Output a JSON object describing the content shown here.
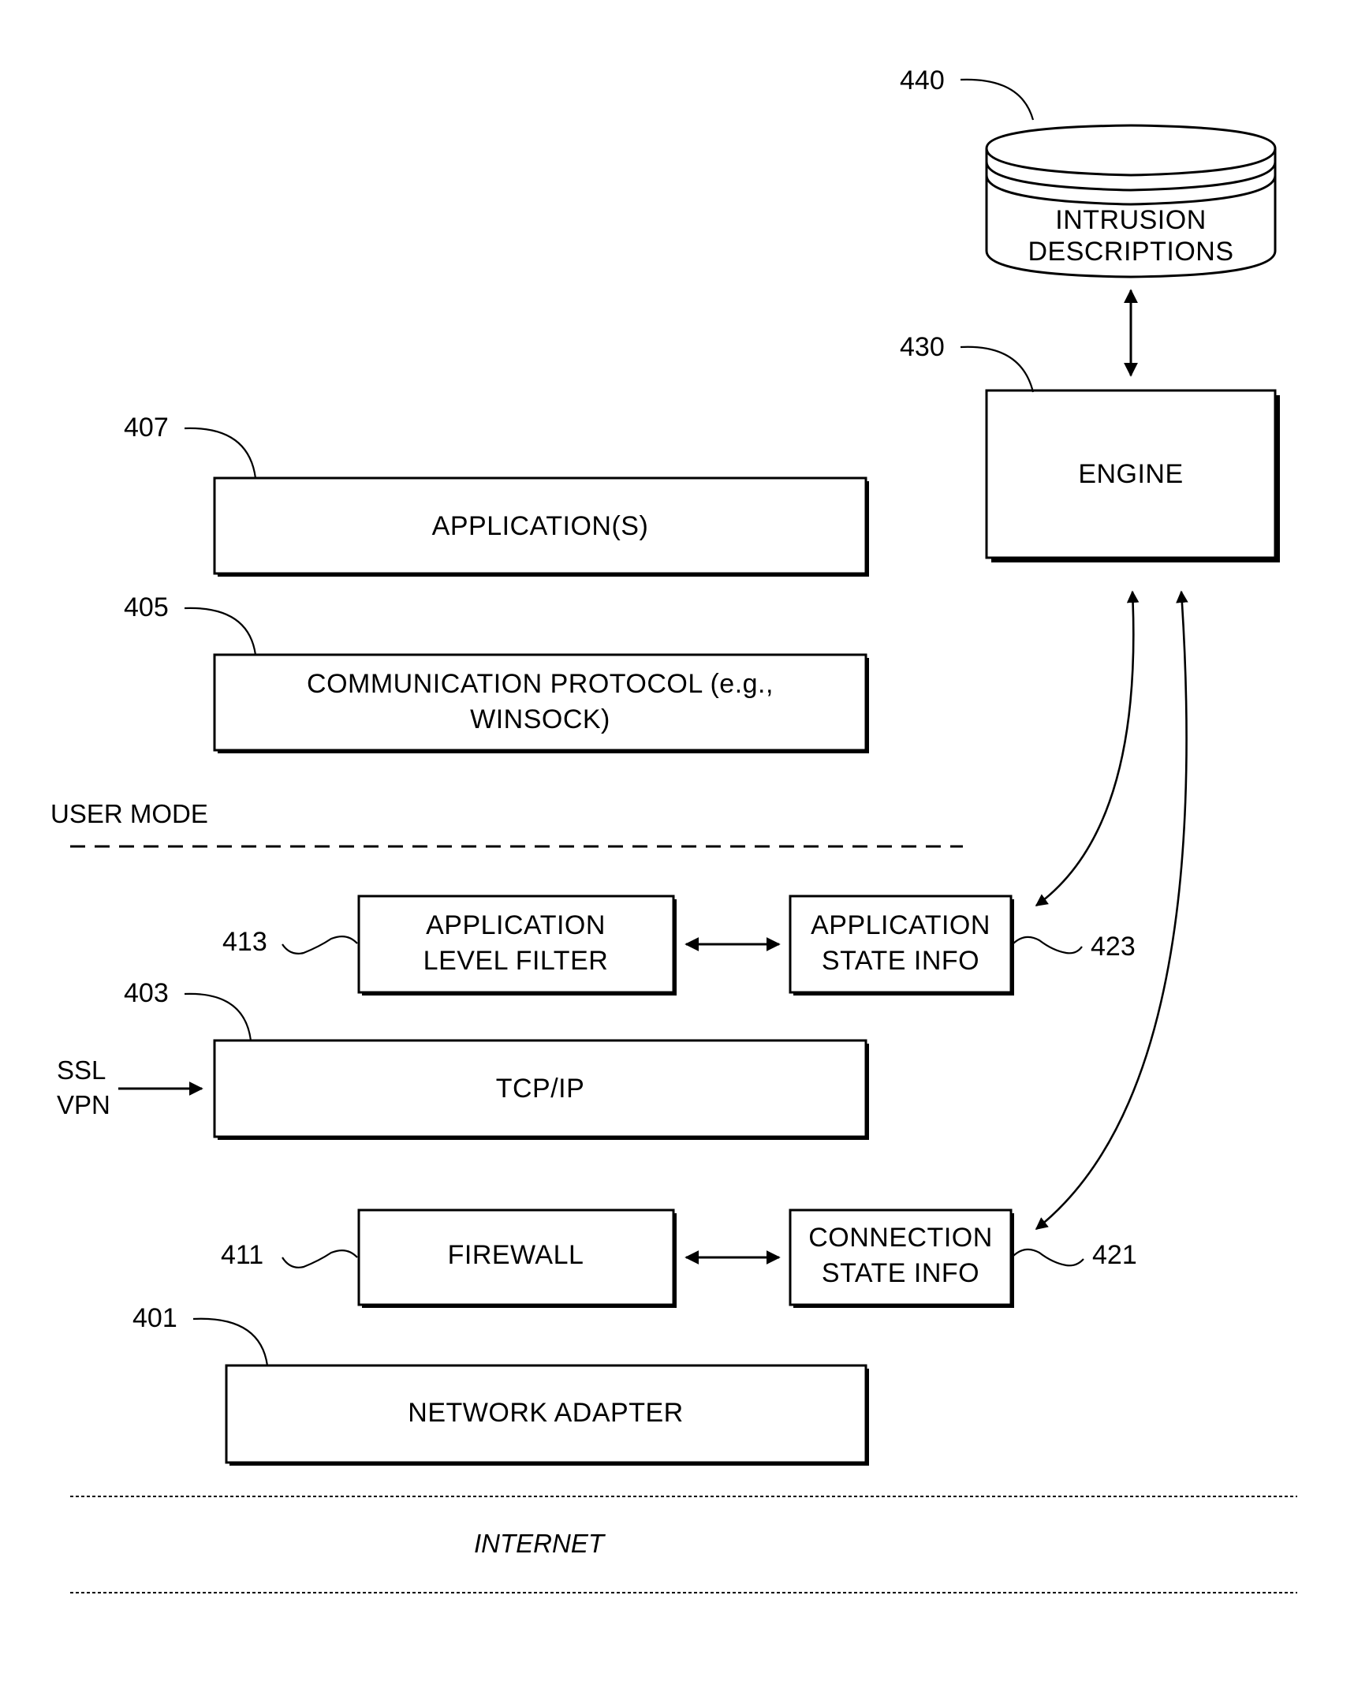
{
  "diagram": {
    "colors": {
      "ink": "#000000",
      "background": "#ffffff"
    },
    "database": {
      "ref": "440",
      "lines": [
        "INTRUSION",
        "DESCRIPTIONS"
      ]
    },
    "engine": {
      "ref": "430",
      "label": "ENGINE"
    },
    "applications": {
      "ref": "407",
      "label": "APPLICATION(S)"
    },
    "comm_protocol": {
      "ref": "405",
      "lines": [
        "COMMUNICATION PROTOCOL (e.g.,",
        "WINSOCK)"
      ]
    },
    "user_mode": {
      "label": "USER MODE"
    },
    "app_level_filter": {
      "ref": "413",
      "lines": [
        "APPLICATION",
        "LEVEL FILTER"
      ]
    },
    "app_state_info": {
      "ref": "423",
      "lines": [
        "APPLICATION",
        "STATE INFO"
      ]
    },
    "tcpip": {
      "ref": "403",
      "label": "TCP/IP"
    },
    "ssl_vpn": {
      "lines": [
        "SSL",
        "VPN"
      ]
    },
    "firewall": {
      "ref": "411",
      "label": "FIREWALL"
    },
    "conn_state_info": {
      "ref": "421",
      "lines": [
        "CONNECTION",
        "STATE INFO"
      ]
    },
    "network_adapter": {
      "ref": "401",
      "label": "NETWORK ADAPTER"
    },
    "internet": {
      "label": "INTERNET"
    }
  }
}
